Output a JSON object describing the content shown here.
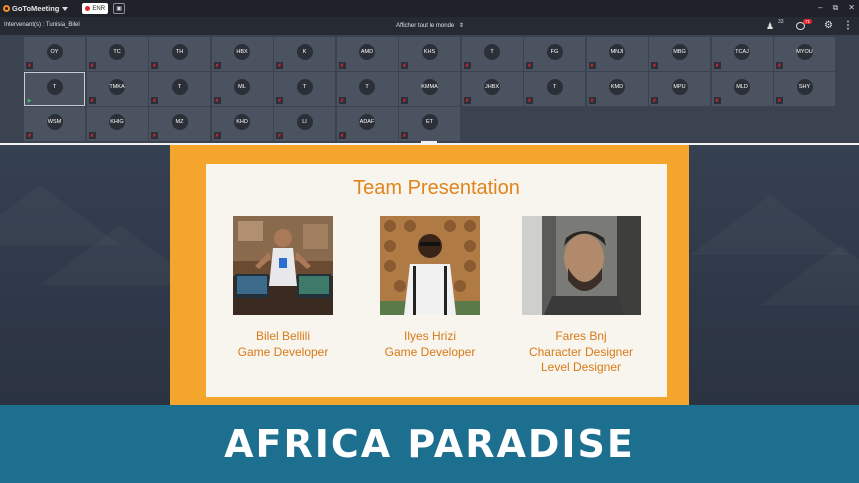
{
  "app": {
    "name": "GoToMeeting",
    "recording_label": "ENR",
    "speaker_label": "Intervenant(s) : Tunisia_Bilel",
    "view_label": "Afficher tout le monde",
    "attendee_count": "33",
    "chat_unread": "71"
  },
  "participants": [
    {
      "initials": "OY",
      "muted": true
    },
    {
      "initials": "TC",
      "muted": true
    },
    {
      "initials": "TH",
      "muted": true
    },
    {
      "initials": "HBX",
      "muted": true
    },
    {
      "initials": "K",
      "muted": true
    },
    {
      "initials": "AMD",
      "muted": true
    },
    {
      "initials": "KHS",
      "muted": true
    },
    {
      "initials": "T",
      "muted": true
    },
    {
      "initials": "FG",
      "muted": true
    },
    {
      "initials": "MNJI",
      "muted": true
    },
    {
      "initials": "MBG",
      "muted": true
    },
    {
      "initials": "TCAJ",
      "muted": true
    },
    {
      "initials": "MYOU",
      "muted": true
    },
    {
      "initials": "T",
      "muted": false,
      "active": true
    },
    {
      "initials": "TMKA",
      "muted": true
    },
    {
      "initials": "T",
      "muted": true
    },
    {
      "initials": "ML",
      "muted": true
    },
    {
      "initials": "T",
      "muted": true
    },
    {
      "initials": "T",
      "muted": true
    },
    {
      "initials": "KMMA",
      "muted": true
    },
    {
      "initials": "JHBX",
      "muted": true
    },
    {
      "initials": "T",
      "muted": true
    },
    {
      "initials": "KMD",
      "muted": true
    },
    {
      "initials": "MPU",
      "muted": true
    },
    {
      "initials": "MLD",
      "muted": true
    },
    {
      "initials": "SHY",
      "muted": true
    },
    {
      "initials": "WSM",
      "muted": true
    },
    {
      "initials": "KHIG",
      "muted": true
    },
    {
      "initials": "MZ",
      "muted": true
    },
    {
      "initials": "KHD",
      "muted": true
    },
    {
      "initials": "LI",
      "muted": true
    },
    {
      "initials": "ADAF",
      "muted": true
    },
    {
      "initials": "ET",
      "muted": true
    }
  ],
  "slide": {
    "title": "Team Presentation",
    "members": [
      {
        "name": "Bilel Bellili",
        "role1": "Game Developer",
        "role2": ""
      },
      {
        "name": "Ilyes Hrizi",
        "role1": "Game Developer",
        "role2": ""
      },
      {
        "name": "Fares Bnj",
        "role1": "Character Designer",
        "role2": "Level Designer"
      }
    ]
  },
  "banner": {
    "text": "AFRICA PARADISE"
  },
  "colors": {
    "slide_border": "#f4a52c",
    "slide_text": "#d97a18",
    "banner_bg": "#1d6f8f",
    "record_dot": "#e0242e"
  }
}
